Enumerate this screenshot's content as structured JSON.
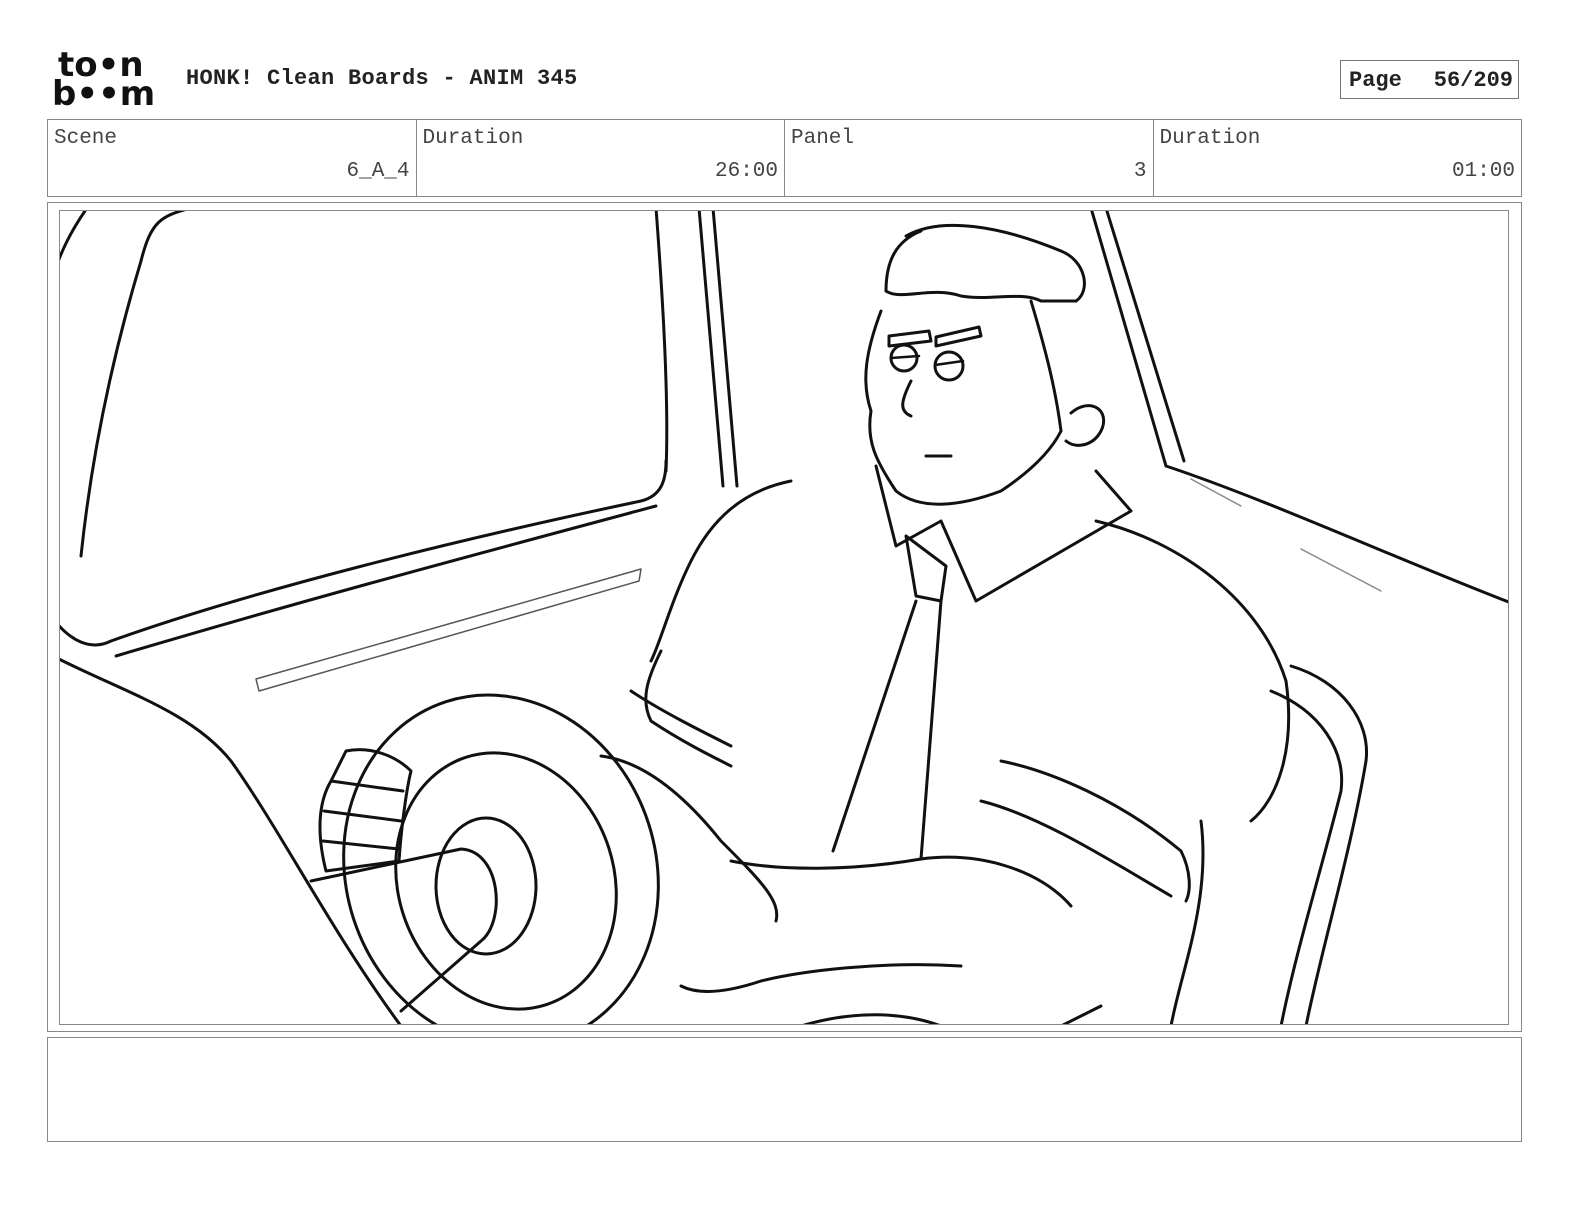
{
  "header": {
    "logo_line1": "to•n",
    "logo_line2": "b••m",
    "title": "HONK! Clean Boards - ANIM 345",
    "page_label": "Page",
    "page_value": "56/209"
  },
  "info": {
    "scene_label": "Scene",
    "scene_value": "6_A_4",
    "scene_duration_label": "Duration",
    "scene_duration_value": "26:00",
    "panel_label": "Panel",
    "panel_value": "3",
    "panel_duration_label": "Duration",
    "panel_duration_value": "01:00"
  },
  "panel": {
    "drawing": "man-driving-car-sketch"
  },
  "notes": {
    "text": ""
  }
}
